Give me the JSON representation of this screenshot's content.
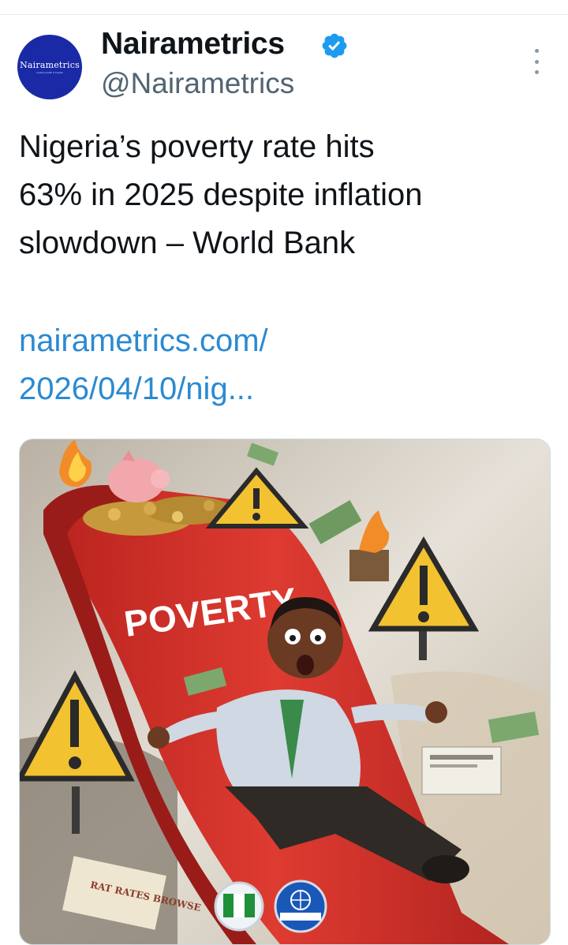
{
  "tweet": {
    "author": {
      "name": "Nairametrics",
      "handle": "@Nairametrics",
      "verified": true,
      "avatar_text": "Nairametrics",
      "avatar_tagline": "Leading wealth & insights"
    },
    "text_lines": [
      "Nigeria’s poverty rate hits",
      "63% in 2025 despite inflation",
      "slowdown – World Bank"
    ],
    "link_lines": [
      "nairametrics.com/",
      "2026/04/10/nig..."
    ],
    "media": {
      "slide_label": "POVERTY",
      "paper_text": "RAT RATES BROWSE"
    }
  },
  "colors": {
    "link": "#2b8ad1",
    "verified": "#1d9bf0",
    "avatar_bg": "#1a2aa6",
    "slide_red": "#d8362f",
    "warning_yellow": "#f2c230"
  },
  "icons": {
    "verified": "verified-badge-icon",
    "more": "more-dots-icon",
    "warning": "warning-triangle-icon",
    "flag": "nigeria-flag-icon",
    "globe": "world-bank-globe-icon"
  }
}
